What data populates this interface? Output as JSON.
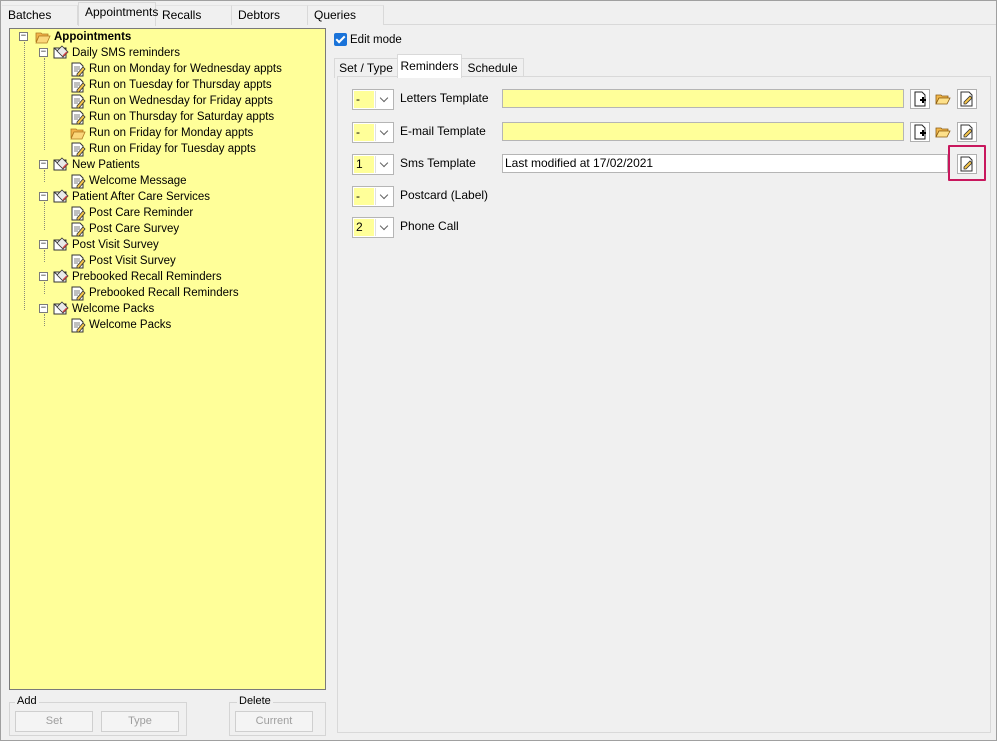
{
  "top_tabs": [
    "Batches",
    "Appointments",
    "Recalls",
    "Debtors",
    "Queries"
  ],
  "tree": {
    "root": "Appointments",
    "groups": [
      {
        "label": "Daily SMS reminders",
        "items": [
          "Run on Monday for Wednesday appts",
          "Run on Tuesday for Thursday appts",
          "Run on Wednesday for Friday appts",
          "Run on Thursday for Saturday appts",
          "Run on Friday for Monday appts",
          "Run on Friday for Tuesday appts"
        ]
      },
      {
        "label": "New Patients",
        "items": [
          "Welcome Message"
        ]
      },
      {
        "label": "Patient After Care Services",
        "items": [
          "Post Care Reminder",
          "Post Care Survey"
        ]
      },
      {
        "label": "Post Visit Survey",
        "items": [
          "Post Visit Survey"
        ]
      },
      {
        "label": "Prebooked Recall Reminders",
        "items": [
          "Prebooked Recall Reminders"
        ]
      },
      {
        "label": "Welcome Packs",
        "items": [
          "Welcome Packs"
        ]
      }
    ]
  },
  "add_group": {
    "label": "Add",
    "set": "Set",
    "type": "Type"
  },
  "delete_group": {
    "label": "Delete",
    "current": "Current"
  },
  "edit_mode": {
    "label": "Edit mode",
    "checked": true
  },
  "sub_tabs": [
    "Set / Type",
    "Reminders",
    "Schedule"
  ],
  "reminders": {
    "letters": {
      "count": "-",
      "label": "Letters Template",
      "value": ""
    },
    "email": {
      "count": "-",
      "label": "E-mail Template",
      "value": ""
    },
    "sms": {
      "count": "1",
      "label": "Sms Template",
      "value": "Last modified at 17/02/2021"
    },
    "postcard": {
      "count": "-",
      "label": "Postcard (Label)"
    },
    "phone": {
      "count": "2",
      "label": "Phone Call"
    }
  },
  "colors": {
    "tree_bg": "#ffff99",
    "highlight": "#c8175d",
    "checkbox": "#1a73d9"
  }
}
